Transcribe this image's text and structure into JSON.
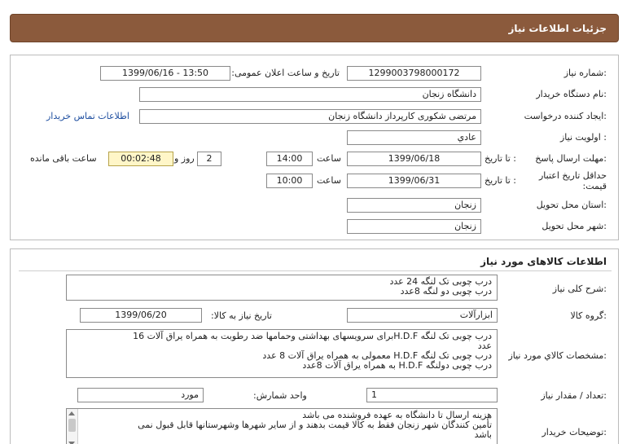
{
  "header": {
    "title": "جزئیات اطلاعات نیاز"
  },
  "details": {
    "need_number": {
      "label": "شماره نیاز:",
      "value": "1299003798000172"
    },
    "announce_datetime": {
      "label": "تاریخ و ساعت اعلان عمومی:",
      "value": "1399/06/16 - 13:50"
    },
    "buyer_org": {
      "label": "نام دستگاه خریدار:",
      "value": "دانشگاه زنجان"
    },
    "requester": {
      "label": "ایجاد کننده درخواست:",
      "value": "مرتضی شکوری کارپرداز دانشگاه زنجان",
      "contact_link": "اطلاعات تماس خریدار"
    },
    "priority": {
      "label": "اولویت نیاز :",
      "value": "عادي"
    },
    "deadline": {
      "label": "مهلت ارسال پاسخ:",
      "to_date_label": "تا تاریخ :",
      "date": "1399/06/18",
      "time_label": "ساعت",
      "time": "14:00",
      "days": "2",
      "days_label": "روز و",
      "remaining": "00:02:48",
      "remaining_label": "ساعت باقی مانده"
    },
    "price_validity": {
      "label_line1": "حداقل تاریخ اعتبار",
      "label_line2": "قیمت:",
      "to_date_label": "تا تاریخ :",
      "date": "1399/06/31",
      "time_label": "ساعت",
      "time": "10:00"
    },
    "delivery_province": {
      "label": "استان محل تحویل:",
      "value": "زنجان"
    },
    "delivery_city": {
      "label": "شهر محل تحویل:",
      "value": "زنجان"
    }
  },
  "goods": {
    "title": "اطلاعات کالاهای مورد نیاز",
    "summary": {
      "label": "شرح کلی نیاز:",
      "lines": [
        "درب چوبی تک لنگه  24 عدد",
        "درب چوبی دو لنگه 8عدد"
      ]
    },
    "group": {
      "label": "گروه کالا:",
      "value": "ابزارآلات",
      "need_date_label": "تاریخ نیاز به کالا:",
      "need_date": "1399/06/20"
    },
    "specs": {
      "label": "مشخصات کالاي مورد نياز:",
      "lines": [
        "درب چوبی تک لنگه H.D.Fبرای سرویسهای بهداشتی وحمامها ضد رطوبت به همراه یراق آلات   16",
        "عدد",
        "درب چوبی تک لنگه H.D.F معمولی به همراه یراق آلات 8 عدد",
        "درب چوبی دولنگه H.D.F  به همراه یراق آلات  8عدد"
      ]
    },
    "quantity": {
      "label": "تعداد / مقدار نیاز:",
      "value": "1",
      "unit_label": "واحد شمارش:",
      "unit": "مورد"
    },
    "buyer_notes": {
      "label": "توضیحات خریدار:",
      "lines": [
        "هزینه ارسال تا دانشگاه به عهده فروشنده می باشد",
        "تأمین کنندگان شهر زنجان فقط به کالا قیمت بدهند و از سایر شهرها وشهرستانها قابل قبول نمی",
        "باشد"
      ]
    }
  }
}
